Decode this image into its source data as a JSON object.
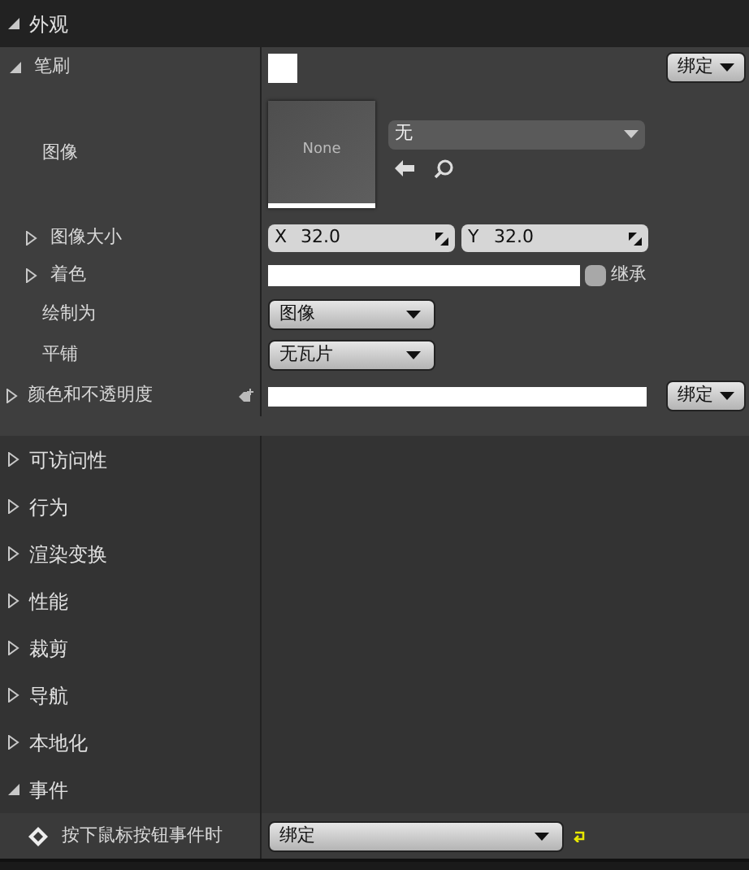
{
  "appearance": {
    "title": "外观",
    "expanded": true,
    "brush": {
      "label": "笔刷",
      "expanded": true,
      "bind_button": "绑定",
      "image": {
        "label": "图像",
        "thumbnail_text": "None",
        "asset_value": "无"
      },
      "image_size": {
        "label": "图像大小",
        "expanded": false,
        "x_label": "X",
        "x_value": "32.0",
        "y_label": "Y",
        "y_value": "32.0"
      },
      "tint": {
        "label": "着色",
        "expanded": false,
        "inherit_label": "继承",
        "inherit_checked": false
      },
      "draw_as": {
        "label": "绘制为",
        "value": "图像"
      },
      "tiling": {
        "label": "平铺",
        "value": "无瓦片"
      }
    },
    "color_opacity": {
      "label": "颜色和不透明度",
      "expanded": false,
      "bind_button": "绑定"
    }
  },
  "categories": [
    {
      "title": "可访问性",
      "expanded": false
    },
    {
      "title": "行为",
      "expanded": false
    },
    {
      "title": "渲染变换",
      "expanded": false
    },
    {
      "title": "性能",
      "expanded": false
    },
    {
      "title": "裁剪",
      "expanded": false
    },
    {
      "title": "导航",
      "expanded": false
    },
    {
      "title": "本地化",
      "expanded": false
    }
  ],
  "events": {
    "title": "事件",
    "expanded": true,
    "items": [
      {
        "label": "按下鼠标按钮事件时",
        "value": "绑定"
      }
    ]
  }
}
